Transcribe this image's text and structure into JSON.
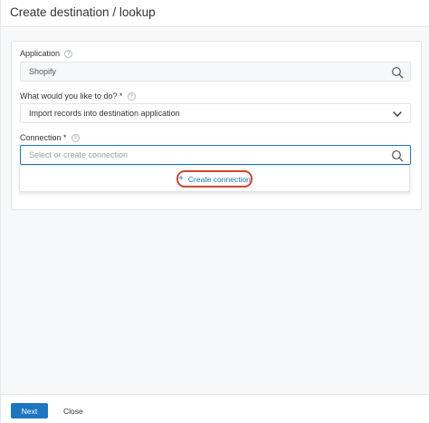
{
  "header": {
    "title": "Create destination / lookup"
  },
  "form": {
    "application": {
      "label": "Application",
      "help": "?",
      "value": "Shopify"
    },
    "action": {
      "label": "What would you like to do? *",
      "help": "?",
      "value": "Import records into destination application"
    },
    "connection": {
      "label": "Connection *",
      "help": "?",
      "placeholder": "Select or create connection"
    },
    "dropdown": {
      "create_connection_label": "Create connection",
      "plus": "+"
    }
  },
  "footer": {
    "next_label": "Next",
    "close_label": "Close"
  },
  "colors": {
    "primary": "#1d76c2",
    "highlight": "#d9442f",
    "border": "#e1e4e7",
    "background": "#f7f8f9"
  }
}
